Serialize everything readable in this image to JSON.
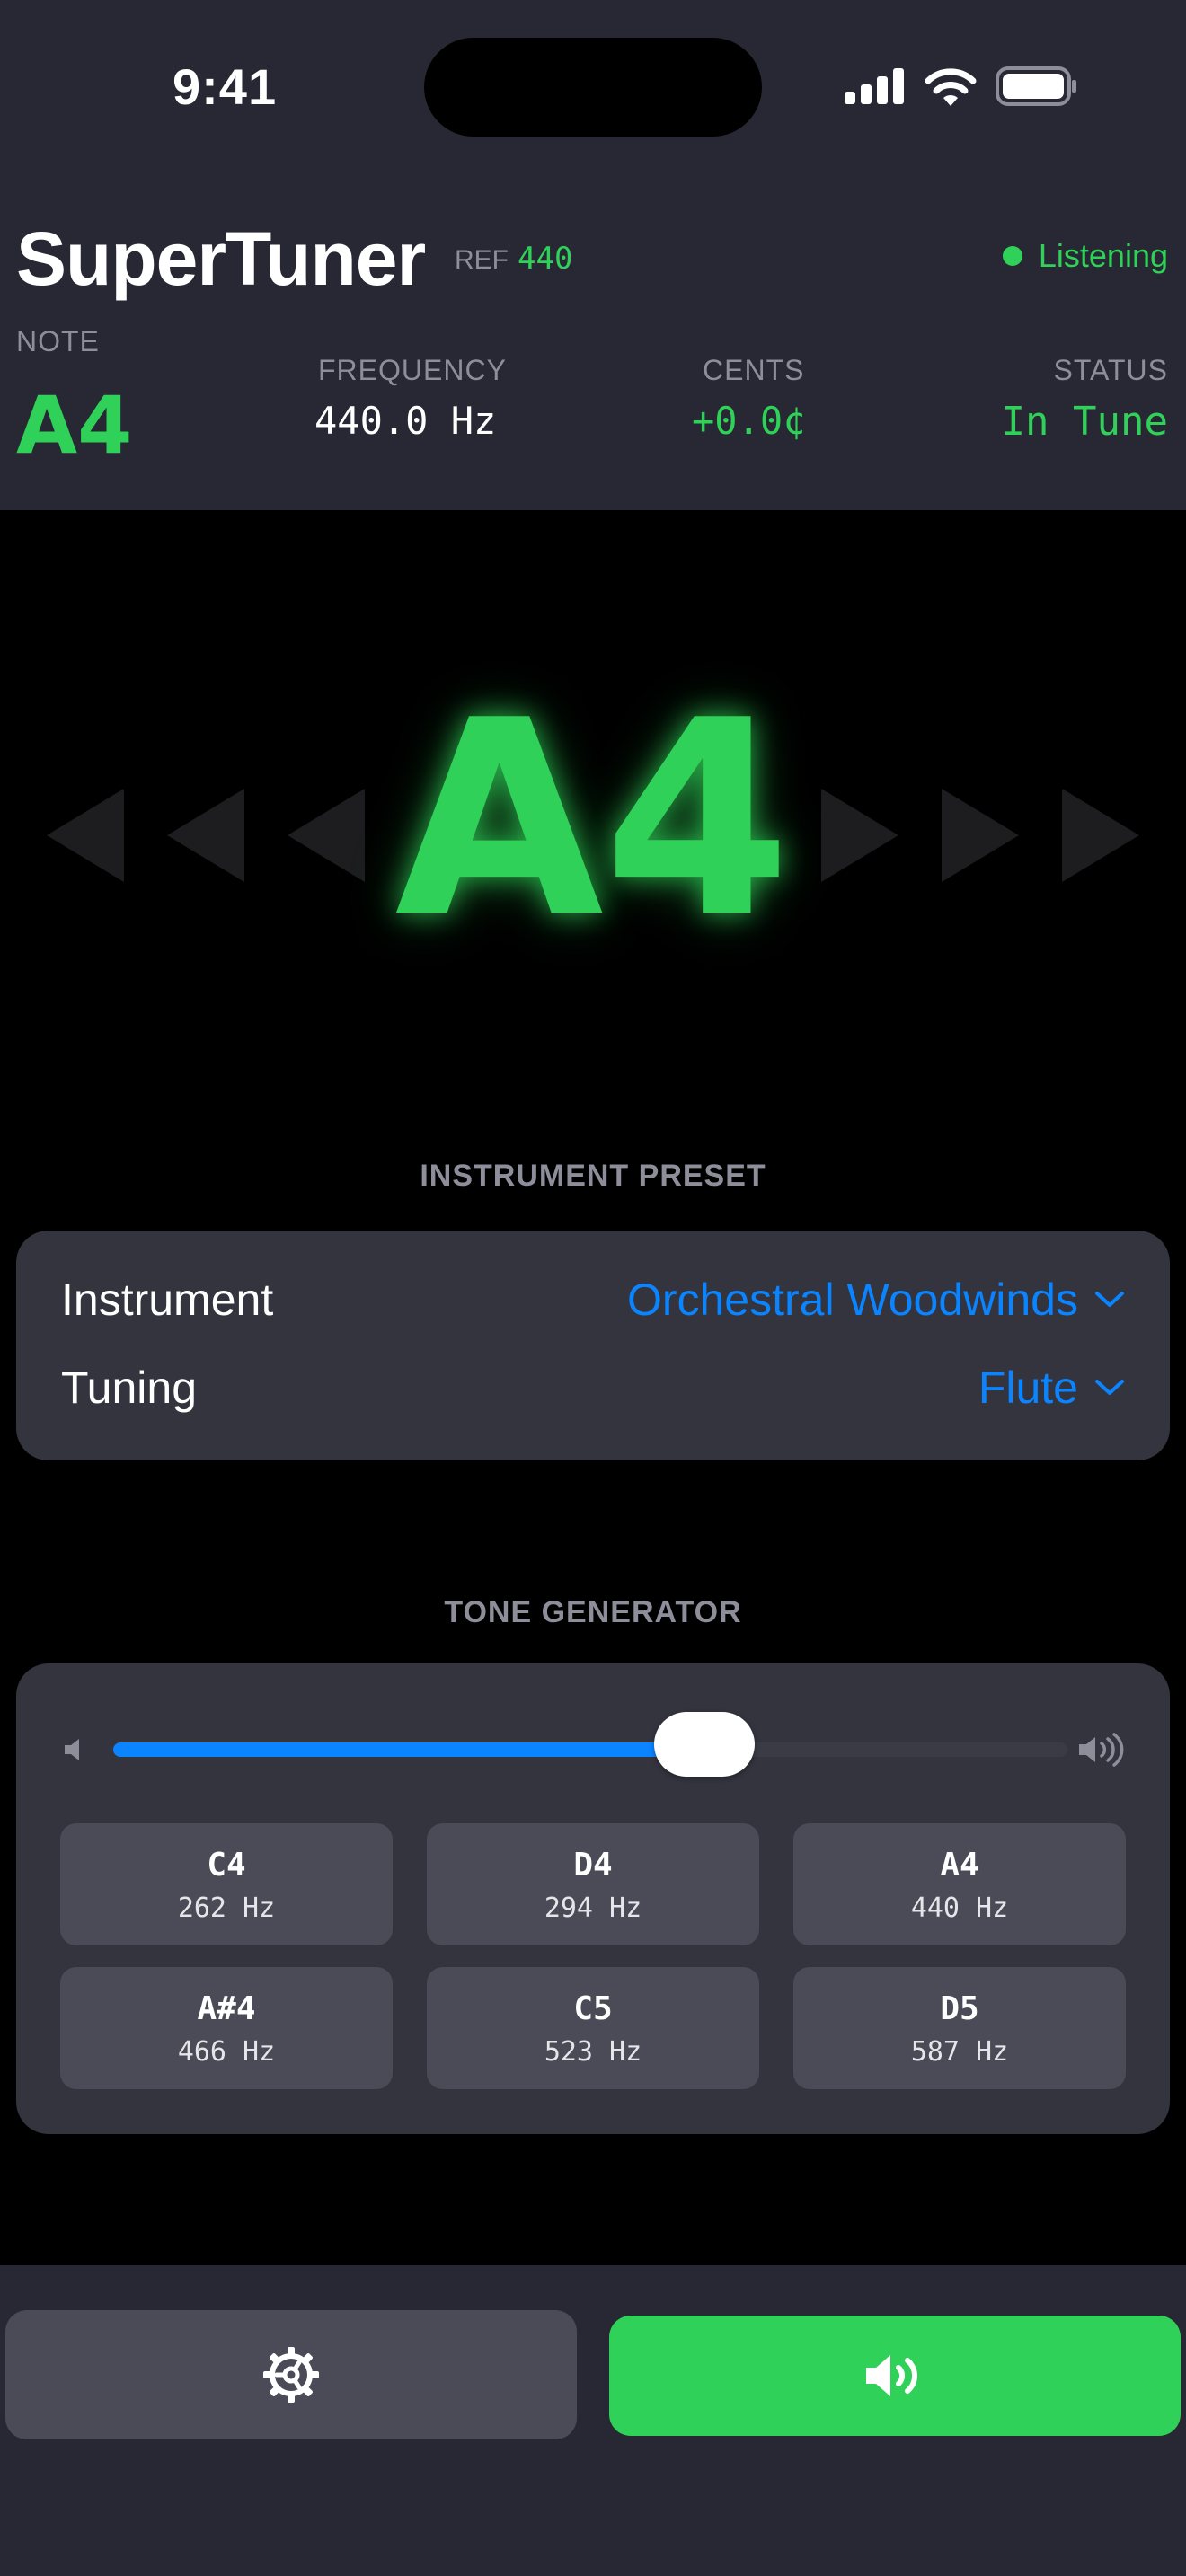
{
  "status_bar": {
    "time": "9:41"
  },
  "app": {
    "title": "SuperTuner",
    "ref_label": "REF",
    "ref_value": "440",
    "listening": "Listening"
  },
  "readout": {
    "note_label": "NOTE",
    "note_value": "A4",
    "frequency_label": "FREQUENCY",
    "frequency_value": "440.0 Hz",
    "cents_label": "CENTS",
    "cents_value": "+0.0¢",
    "status_label": "STATUS",
    "status_value": "In Tune"
  },
  "display": {
    "note": "A4"
  },
  "preset": {
    "section_title": "INSTRUMENT PRESET",
    "instrument_label": "Instrument",
    "instrument_value": "Orchestral Woodwinds",
    "tuning_label": "Tuning",
    "tuning_value": "Flute"
  },
  "tone_generator": {
    "section_title": "TONE GENERATOR",
    "volume_fraction": 0.62,
    "tones": [
      {
        "note": "C4",
        "hz": "262 Hz"
      },
      {
        "note": "D4",
        "hz": "294 Hz"
      },
      {
        "note": "A4",
        "hz": "440 Hz"
      },
      {
        "note": "A#4",
        "hz": "466 Hz"
      },
      {
        "note": "C5",
        "hz": "523 Hz"
      },
      {
        "note": "D5",
        "hz": "587 Hz"
      }
    ]
  },
  "colors": {
    "accent_green": "#30d158",
    "accent_blue": "#0a84ff",
    "panel": "#272833",
    "card": "#33343e"
  },
  "icons": [
    "signal-icon",
    "wifi-icon",
    "battery-icon",
    "speaker-low-icon",
    "speaker-high-icon",
    "settings-gear-icon",
    "speaker-play-icon",
    "chevron-down-icon"
  ]
}
